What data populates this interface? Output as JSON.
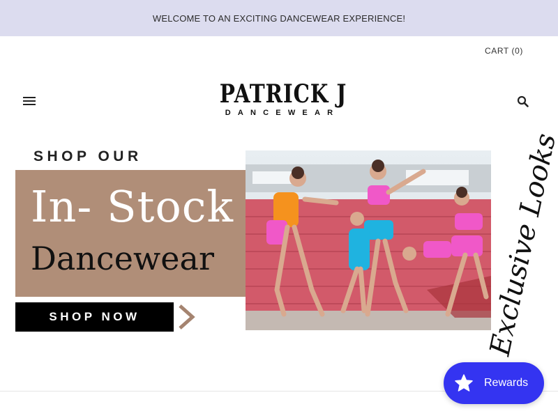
{
  "announcement": {
    "text": "WELCOME TO AN EXCITING DANCEWEAR EXPERIENCE!"
  },
  "header": {
    "cart_label": "CART (0)",
    "logo_title": "PATRICK J",
    "logo_subtitle": "DANCEWEAR",
    "menu_icon": "hamburger-menu-icon",
    "search_icon": "search-icon"
  },
  "banner": {
    "kicker": "SHOP OUR",
    "headline": "In- Stock",
    "subheadline": "Dancewear",
    "cta_label": "SHOP NOW",
    "script_text": "Exclusive Looks",
    "colors": {
      "tan": "#b08e78",
      "cta_bg": "#000000",
      "arrow": "#a58470"
    }
  },
  "rewards": {
    "label": "Rewards",
    "icon": "star-icon",
    "color": "#3434f1"
  }
}
